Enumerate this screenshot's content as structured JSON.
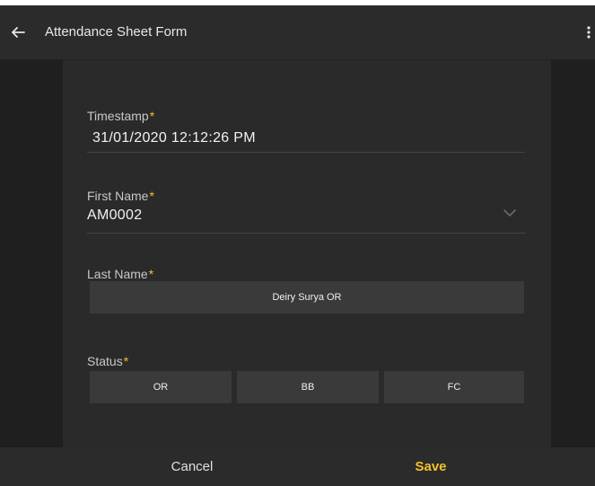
{
  "header": {
    "title": "Attendance Sheet Form",
    "back_icon": "arrow-left-icon",
    "more_icon": "more-vertical-icon"
  },
  "form": {
    "timestamp": {
      "label": "Timestamp",
      "required_mark": "*",
      "value": "31/01/2020 12:12:26 PM"
    },
    "first_name": {
      "label": "First Name",
      "required_mark": "*",
      "value": "AM0002",
      "dropdown_icon": "chevron-down-icon"
    },
    "last_name": {
      "label": "Last Name",
      "required_mark": "*",
      "value": "Deiry Surya OR"
    },
    "status": {
      "label": "Status",
      "required_mark": "*",
      "options": [
        "OR",
        "BB",
        "FC"
      ]
    }
  },
  "footer": {
    "cancel_label": "Cancel",
    "save_label": "Save"
  },
  "colors": {
    "background": "#1f1f1f",
    "panel": "#2a2a2a",
    "field": "#3a3a3a",
    "accent": "#f2c12e",
    "text": "#f0f0f0"
  }
}
